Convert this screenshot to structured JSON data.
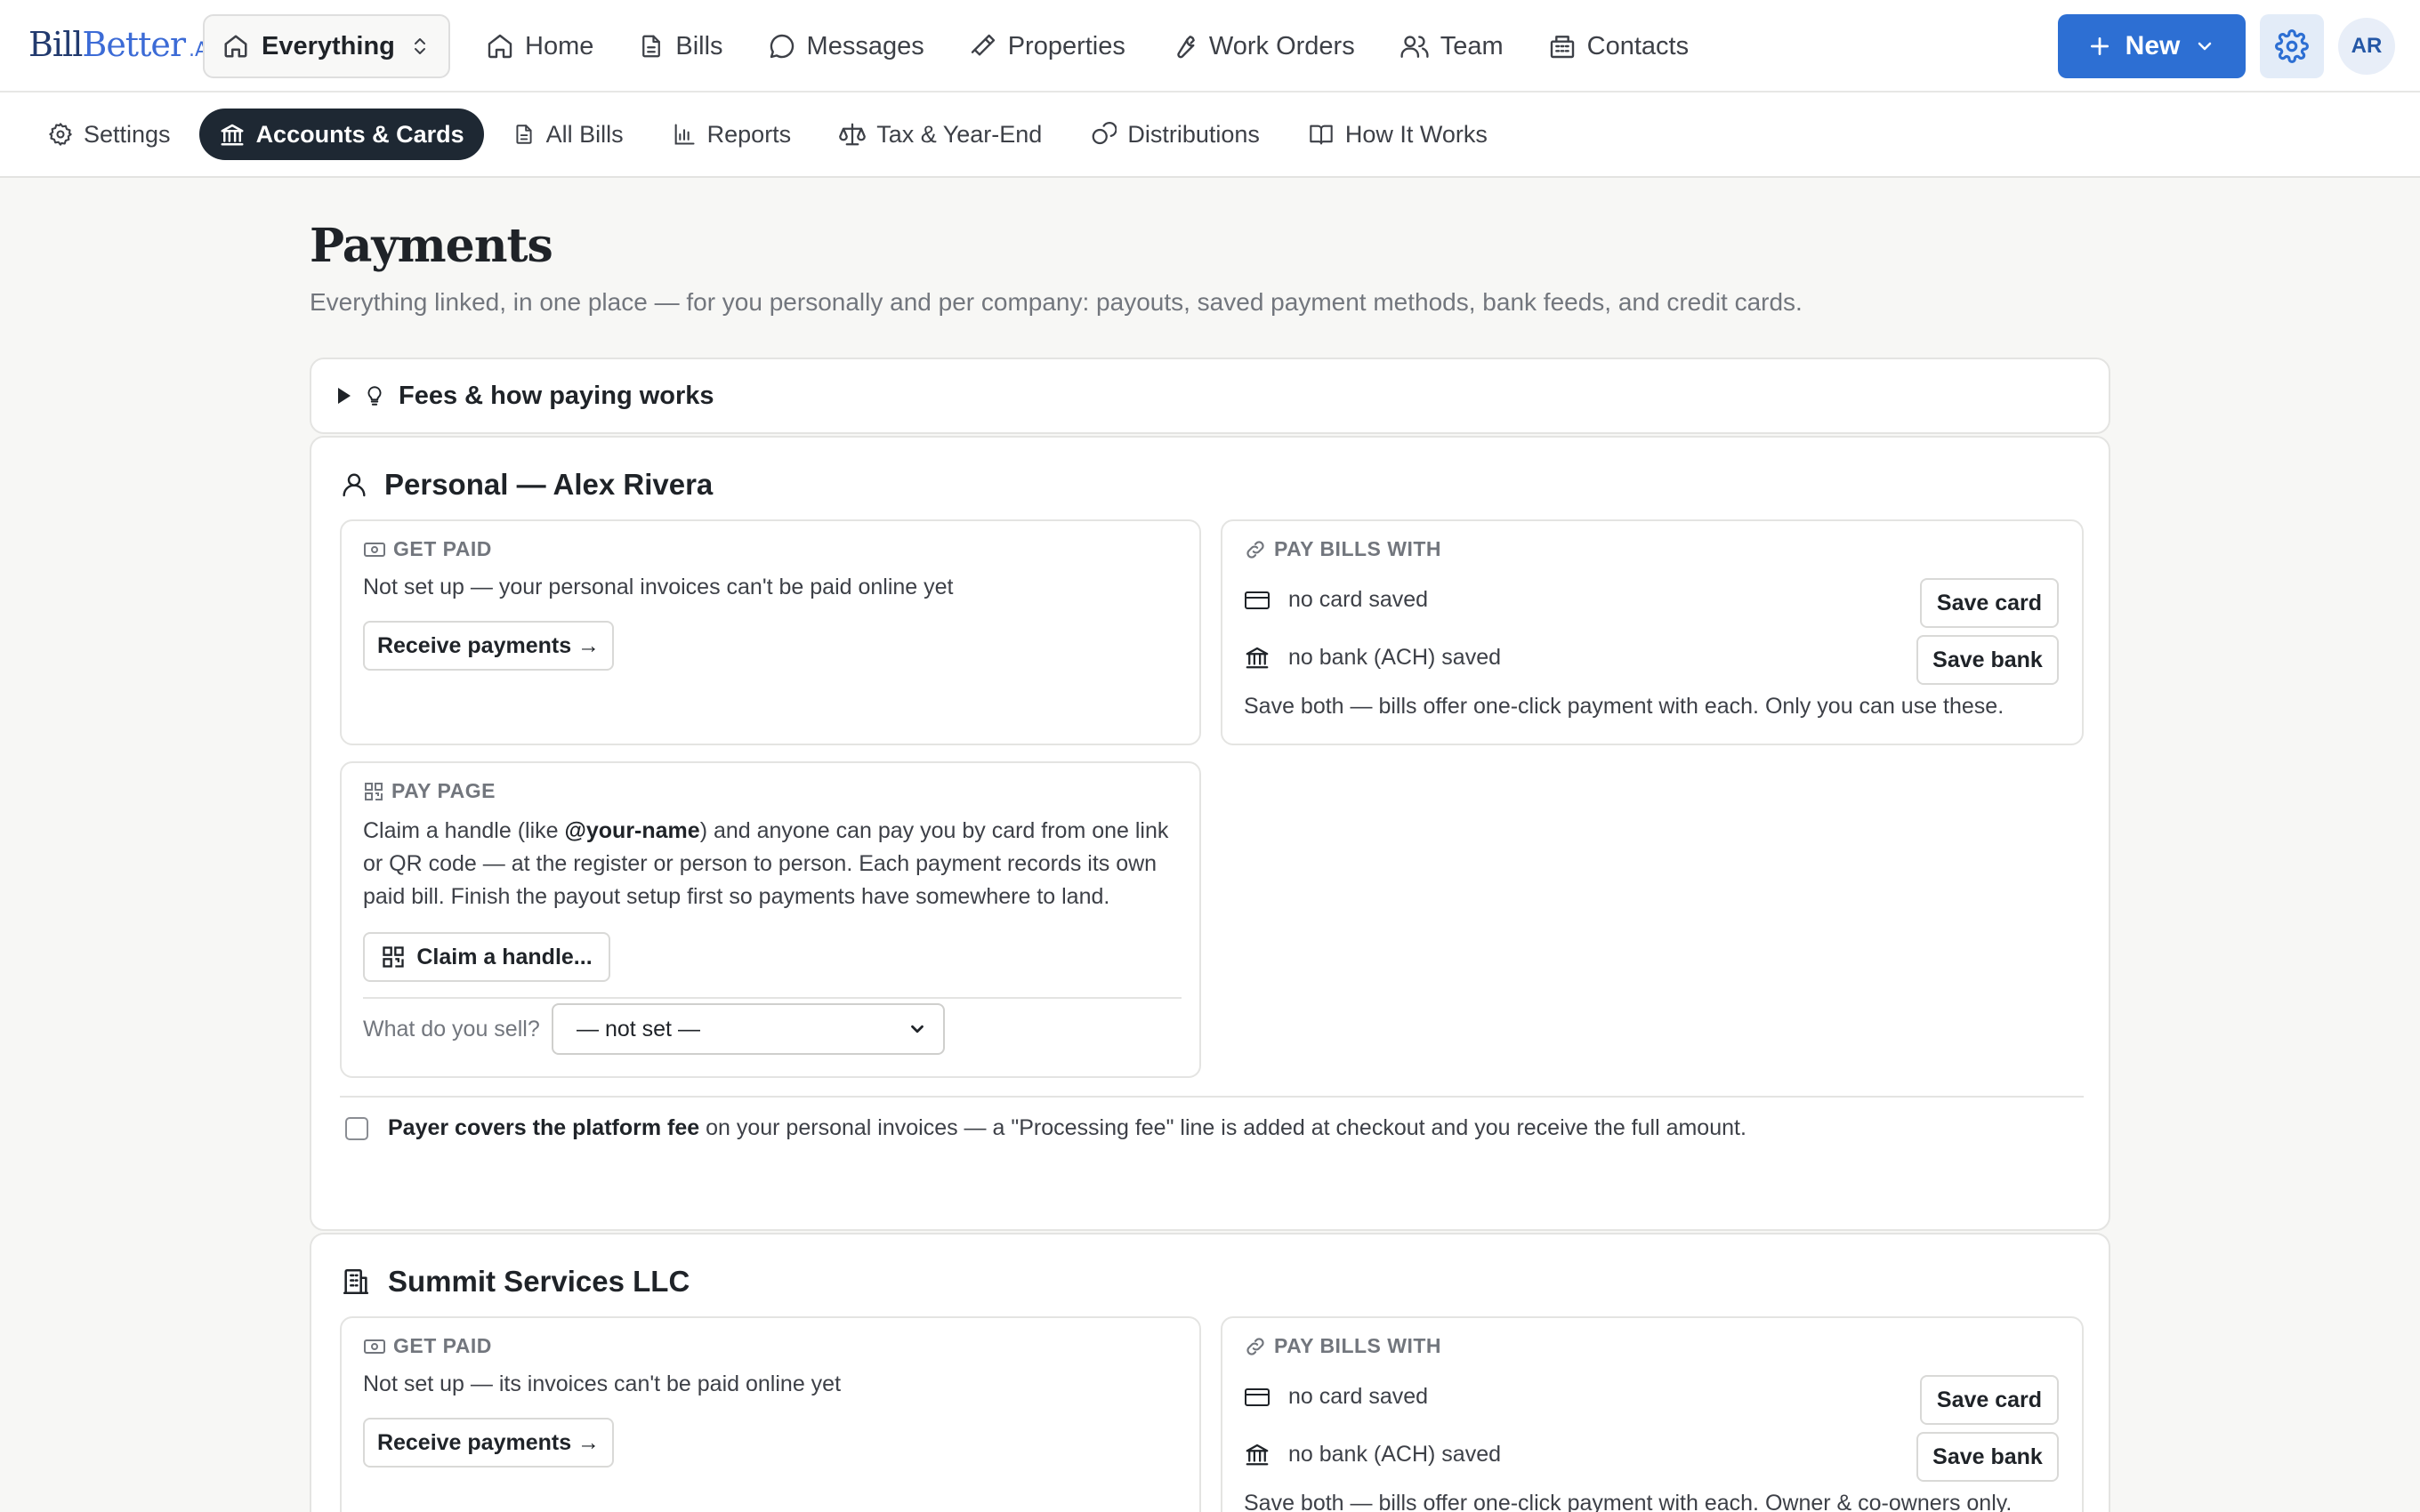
{
  "header": {
    "logo": {
      "part1": "Bill",
      "part2": "Better",
      "part3": ".AI"
    },
    "scope": "Everything",
    "nav": [
      "Home",
      "Bills",
      "Messages",
      "Properties",
      "Work Orders",
      "Team",
      "Contacts"
    ],
    "new_label": "New",
    "avatar": "AR"
  },
  "subnav": [
    "Settings",
    "Accounts & Cards",
    "All Bills",
    "Reports",
    "Tax & Year-End",
    "Distributions",
    "How It Works"
  ],
  "page": {
    "title": "Payments",
    "subtitle": "Everything linked, in one place — for you personally and per company: payouts, saved payment methods, bank feeds, and credit cards."
  },
  "fees": {
    "label": "Fees & how paying works"
  },
  "personal": {
    "name": "Personal — Alex Rivera",
    "get_paid": {
      "title": "GET PAID",
      "text": "Not set up — your personal invoices can't be paid online yet",
      "button": "Receive payments →"
    },
    "pay_bills": {
      "title": "PAY BILLS WITH",
      "card": "no card saved",
      "card_button": "Save card",
      "bank": "no bank (ACH) saved",
      "bank_button": "Save bank",
      "note": "Save both — bills offer one-click payment with each. Only you can use these."
    },
    "pay_page": {
      "title": "PAY PAGE",
      "text_pre": "Claim a handle (like ",
      "handle": "@your-name",
      "text_post": ") and anyone can pay you by card from one link or QR code — at the register or person to person. Each payment records its own paid bill. Finish the payout setup first so payments have somewhere to land.",
      "button": "Claim a handle...",
      "sell_label": "What do you sell?",
      "sell_value": "— not set —"
    },
    "fee_option": {
      "bold": "Payer covers the platform fee",
      "rest": " on your personal invoices — a \"Processing fee\" line is added at checkout and you receive the full amount."
    }
  },
  "company": {
    "name": "Summit Services LLC",
    "get_paid": {
      "title": "GET PAID",
      "text": "Not set up — its invoices can't be paid online yet",
      "button": "Receive payments →"
    },
    "pay_bills": {
      "title": "PAY BILLS WITH",
      "card": "no card saved",
      "card_button": "Save card",
      "bank": "no bank (ACH) saved",
      "bank_button": "Save bank",
      "note": "Save both — bills offer one-click payment with each. Owner & co-owners only."
    }
  }
}
